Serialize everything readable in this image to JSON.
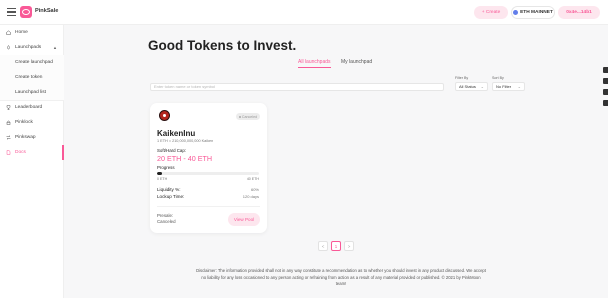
{
  "header": {
    "brand": "PinkSale",
    "create_label": "+ Create",
    "network_label": "ETH MAINNET",
    "wallet_label": "0x4e...14b1"
  },
  "sidebar": {
    "items": [
      {
        "label": "Home",
        "icon": "home-icon"
      },
      {
        "label": "Launchpads",
        "icon": "rocket-icon"
      },
      {
        "label": "Create launchpad"
      },
      {
        "label": "Create token"
      },
      {
        "label": "Launchpad list"
      },
      {
        "label": "Leaderboard",
        "icon": "trophy-icon"
      },
      {
        "label": "Pinklock",
        "icon": "lock-icon"
      },
      {
        "label": "Pinkswap",
        "icon": "swap-icon"
      },
      {
        "label": "Docs",
        "icon": "document-icon"
      }
    ]
  },
  "main": {
    "title": "Good Tokens to Invest.",
    "tabs": [
      {
        "label": "All launchpads",
        "active": true
      },
      {
        "label": "My launchpad",
        "active": false
      }
    ],
    "search_placeholder": "Enter token name or token symbol",
    "filter": {
      "label": "Filter By",
      "value": "All Status"
    },
    "sort": {
      "label": "Sort By",
      "value": "No Filter"
    }
  },
  "card": {
    "status": "Canceled",
    "name": "KaikenInu",
    "rate": "1 ETH = 210,000,000,000 Kaiken",
    "cap_label": "Soft/Hard Cap:",
    "cap_value": "20 ETH - 40 ETH",
    "progress_label": "Progress",
    "progress_fraction": 0.05,
    "progress_left": "0 ETH",
    "progress_right": "40 ETH",
    "liquidity_label": "Liquidity %:",
    "liquidity_value": "60%",
    "lockup_label": "Lockup Time:",
    "lockup_value": "120 days",
    "presale_label": "Presale:",
    "presale_value": "Canceled",
    "view_label": "View Pool"
  },
  "pagination": {
    "prev": "<",
    "current": "1",
    "next": ">"
  },
  "disclaimer": "Disclaimer: The information provided shall not in any way constitute a recommendation as to whether you should invest in any product discussed. We accept no liability for any loss occasioned to any person acting or refraining from action as a result of any material provided or published. © 2021 by PinkMoon team!",
  "colors": {
    "accent": "#f95997",
    "accent_light": "#fde6ee",
    "network_dot": "#627eea"
  }
}
